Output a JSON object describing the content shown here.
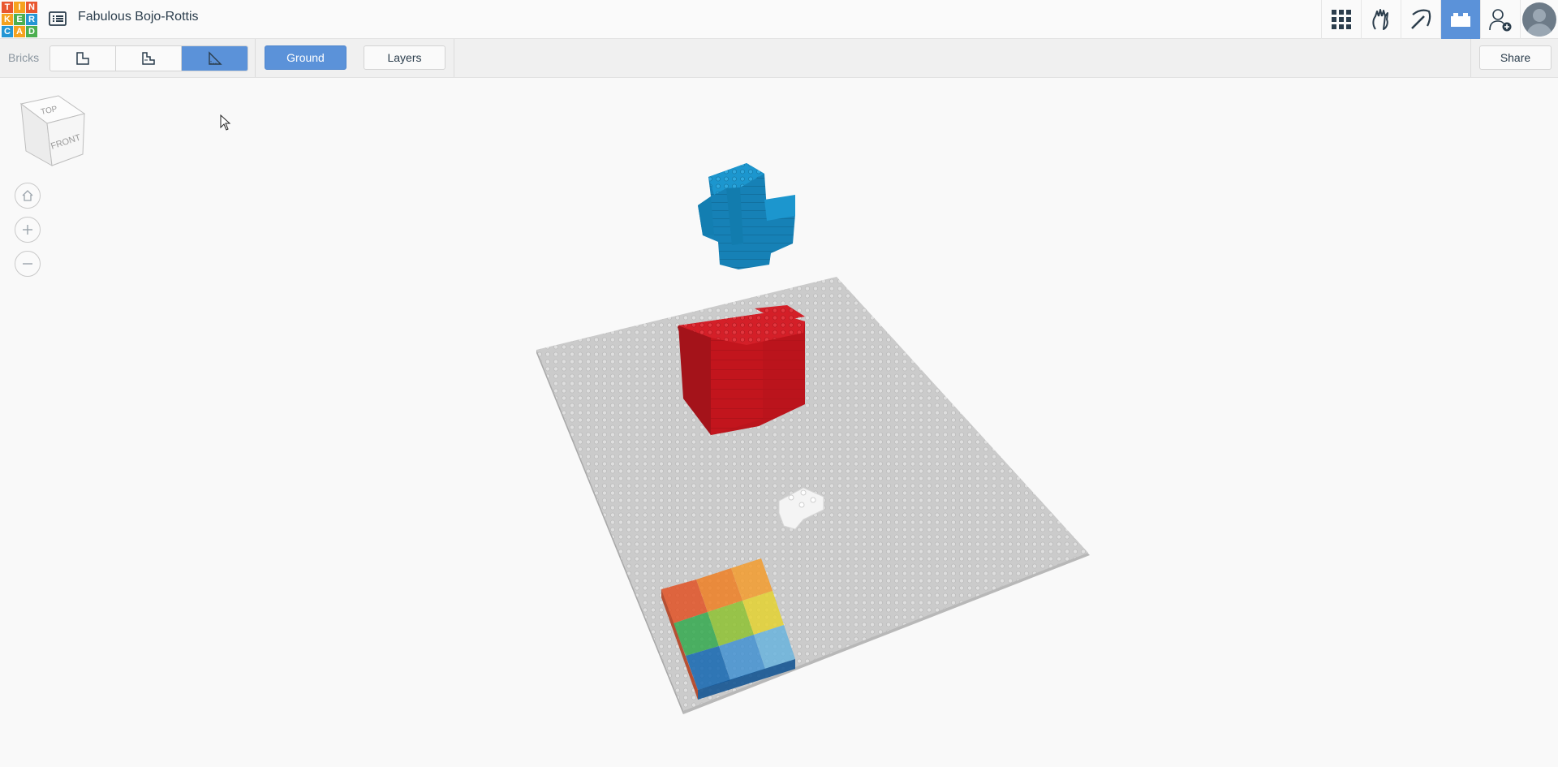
{
  "app": {
    "logo_letters": [
      "T",
      "I",
      "N",
      "K",
      "E",
      "R",
      "C",
      "A",
      "D"
    ],
    "logo_colors": [
      "#e9572f",
      "#f6a21e",
      "#e9572f",
      "#f6a21e",
      "#4caf50",
      "#2496d4",
      "#2496d4",
      "#f6a21e",
      "#4caf50"
    ],
    "design_title": "Fabulous Bojo-Rottis"
  },
  "header_icons": [
    {
      "name": "grid-apps-icon",
      "active": false
    },
    {
      "name": "hands-icon",
      "active": false
    },
    {
      "name": "pickaxe-icon",
      "active": false
    },
    {
      "name": "bricks-view-icon",
      "active": true
    },
    {
      "name": "add-user-icon",
      "active": false
    }
  ],
  "toolbar": {
    "bricks_label": "Bricks",
    "brick_modes": [
      {
        "name": "brick-mode-1-icon",
        "active": false
      },
      {
        "name": "brick-mode-2-icon",
        "active": false
      },
      {
        "name": "brick-mode-3-icon",
        "active": true
      }
    ],
    "ground_label": "Ground",
    "layers_label": "Layers",
    "share_label": "Share"
  },
  "viewcube": {
    "top_label": "TOP",
    "front_label": "FRONT"
  },
  "nav_controls": [
    "home-icon",
    "zoom-in-icon",
    "zoom-out-icon"
  ],
  "scene_colors": {
    "accent": "#5b92d9",
    "baseplate": "#c9c9c9",
    "blue_brick": "#1c94cc",
    "red_brick": "#d01c24",
    "white_brick": "#f2f2f2",
    "palette": [
      "#e24d1f",
      "#f07c1d",
      "#f59a27",
      "#2ea84a",
      "#8cc12c",
      "#e5d22b",
      "#0d63b0",
      "#3e8fd1",
      "#66b2dd"
    ]
  }
}
